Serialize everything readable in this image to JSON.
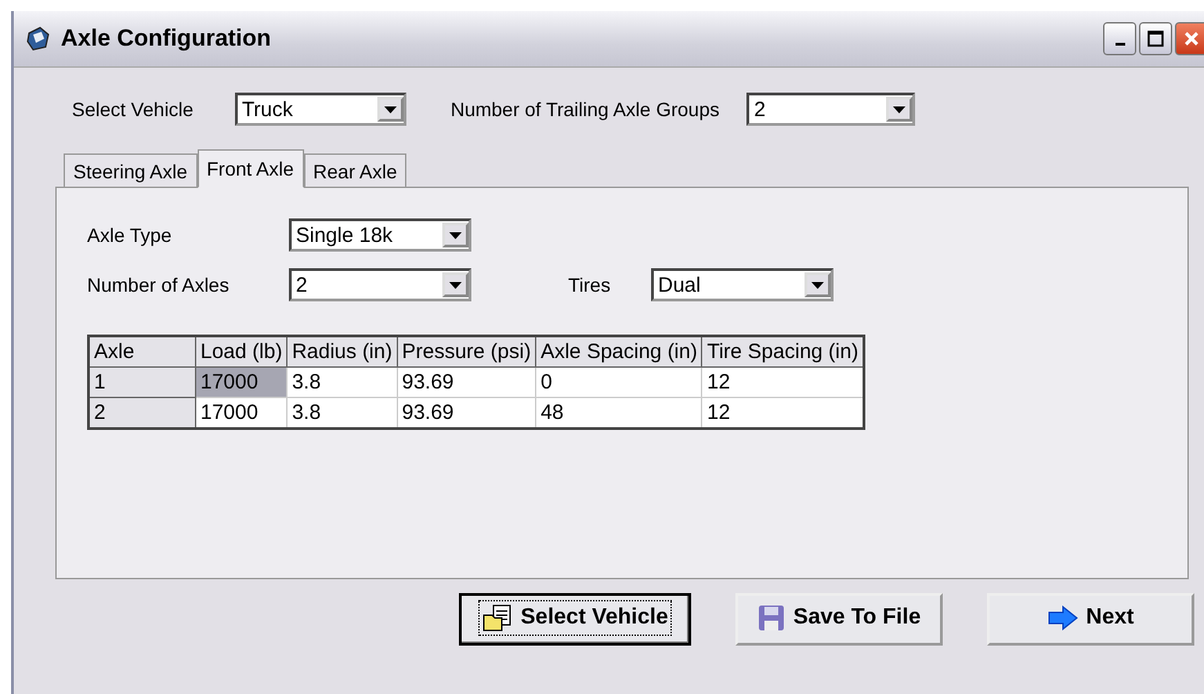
{
  "window": {
    "title": "Axle Configuration"
  },
  "top": {
    "vehicle_label": "Select Vehicle",
    "vehicle_value": "Truck",
    "groups_label": "Number of Trailing Axle Groups",
    "groups_value": "2"
  },
  "tabs": [
    {
      "label": "Steering Axle",
      "selected": false
    },
    {
      "label": "Front Axle",
      "selected": true
    },
    {
      "label": "Rear Axle",
      "selected": false
    }
  ],
  "panel": {
    "axle_type_label": "Axle Type",
    "axle_type_value": "Single 18k",
    "axles_label": "Number of Axles",
    "axles_value": "2",
    "tires_label": "Tires",
    "tires_value": "Dual"
  },
  "table": {
    "columns": [
      "Axle",
      "Load (lb)",
      "Radius (in)",
      "Pressure (psi)",
      "Axle Spacing (in)",
      "Tire Spacing (in)"
    ],
    "rows": [
      {
        "cells": [
          {
            "text": "1",
            "selected": false
          },
          {
            "text": "17000",
            "selected": true
          },
          {
            "text": "3.8",
            "selected": false
          },
          {
            "text": "93.69",
            "selected": false
          },
          {
            "text": "0",
            "selected": false
          },
          {
            "text": "12",
            "selected": false
          }
        ]
      },
      {
        "cells": [
          {
            "text": "2",
            "selected": false
          },
          {
            "text": "17000",
            "selected": false
          },
          {
            "text": "3.8",
            "selected": false
          },
          {
            "text": "93.69",
            "selected": false
          },
          {
            "text": "48",
            "selected": false
          },
          {
            "text": "12",
            "selected": false
          }
        ]
      }
    ]
  },
  "buttons": [
    {
      "label": "Select Vehicle",
      "kind": "open",
      "focused": true
    },
    {
      "label": "Save To File",
      "kind": "save",
      "focused": false
    },
    {
      "label": "Next",
      "kind": "next",
      "focused": false
    }
  ]
}
